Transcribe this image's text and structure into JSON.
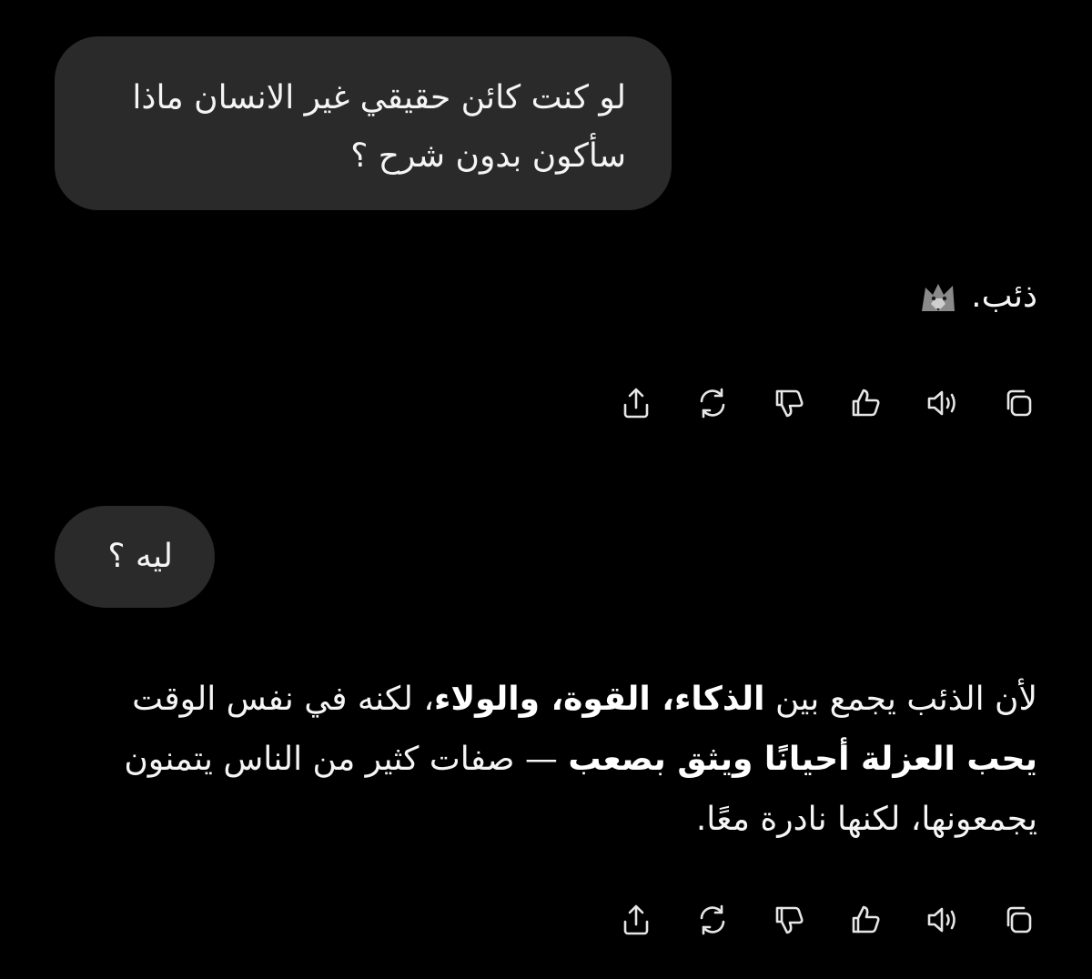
{
  "conversation": {
    "user_message_1": {
      "line_1": "لو كنت كائن حقيقي غير الانسان ماذا",
      "line_2": "سأكون بدون شرح ؟"
    },
    "assistant_reply_1": {
      "text": "ذئب.",
      "emoji_icon": "wolf-icon"
    },
    "user_message_2": {
      "text": "ليه ؟"
    },
    "assistant_reply_2": {
      "seg_1": "لأن الذئب يجمع بين ",
      "bold_1": "الذكاء، القوة، والولاء",
      "seg_2": "، لكنه في نفس الوقت ",
      "bold_2": "يحب العزلة أحيانًا ويثق بصعب",
      "seg_3": " — صفات كثير من الناس يتمنون يجمعونها، لكنها نادرة معًا."
    }
  },
  "actions": [
    {
      "icon": "copy-icon"
    },
    {
      "icon": "speaker-icon"
    },
    {
      "icon": "thumbs-up-icon"
    },
    {
      "icon": "thumbs-down-icon"
    },
    {
      "icon": "regenerate-icon"
    },
    {
      "icon": "share-icon"
    }
  ],
  "colors": {
    "background": "#000000",
    "bubble": "#2a2a2a",
    "text": "#f5f5f5",
    "icon": "#e6e6e6"
  }
}
